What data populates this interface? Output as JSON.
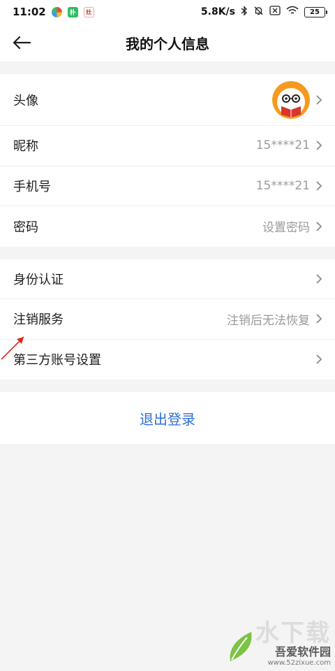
{
  "status_bar": {
    "time": "11:02",
    "icon_app2": "朴",
    "icon_app3": "灶",
    "net_speed": "5.8K/s",
    "battery": "25"
  },
  "header": {
    "title": "我的个人信息"
  },
  "profile": {
    "avatar_label": "头像",
    "nickname_label": "昵称",
    "nickname_value": "15****21",
    "phone_label": "手机号",
    "phone_value": "15****21",
    "password_label": "密码",
    "password_value": "设置密码"
  },
  "account": {
    "identity_label": "身份认证",
    "cancel_label": "注销服务",
    "cancel_value": "注销后无法恢复",
    "third_party_label": "第三方账号设置"
  },
  "logout": {
    "label": "退出登录"
  },
  "watermark": {
    "name": "吾爱软件园",
    "url": "www.52zixue.com"
  },
  "colors": {
    "accent": "#2f6fd6",
    "background": "#f4f4f5",
    "value_gray": "#9a9a9a"
  }
}
